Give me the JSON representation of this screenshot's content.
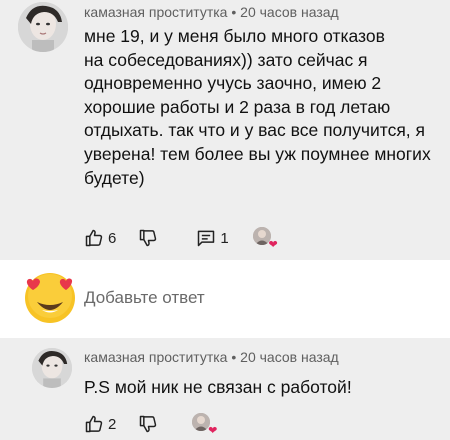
{
  "comments": [
    {
      "author": "камазная проститутка",
      "separator": "•",
      "time": "20 часов назад",
      "lines": [
        "мне 19, и у меня было много отказов",
        "на собеседованиях)) зато сейчас я",
        "одновременно учусь заочно, имею 2",
        "хорошие работы и 2 раза в год летаю",
        "отдыхать. так что и у вас все получится, я",
        "уверена! тем более вы уж поумнее многих",
        "будете)"
      ],
      "likes": "6",
      "replies": "1"
    },
    {
      "author": "камазная проститутка",
      "separator": "•",
      "time": "20 часов назад",
      "lines": [
        "P.S мой ник не связан с работой!"
      ],
      "likes": "2"
    }
  ],
  "reply_box": {
    "placeholder": "Добавьте ответ"
  },
  "icons": {
    "like": "thumbs-up-icon",
    "dislike": "thumbs-down-icon",
    "reply": "comment-icon",
    "creator_heart": "heart-icon",
    "emoji": "heart-eyes-emoji-icon"
  },
  "colors": {
    "comment_bg": "#eeeeee",
    "meta_text": "#5f5f5f",
    "heart": "#e0245e",
    "emoji_face": "#f7c325",
    "emoji_heart": "#e8374b"
  }
}
